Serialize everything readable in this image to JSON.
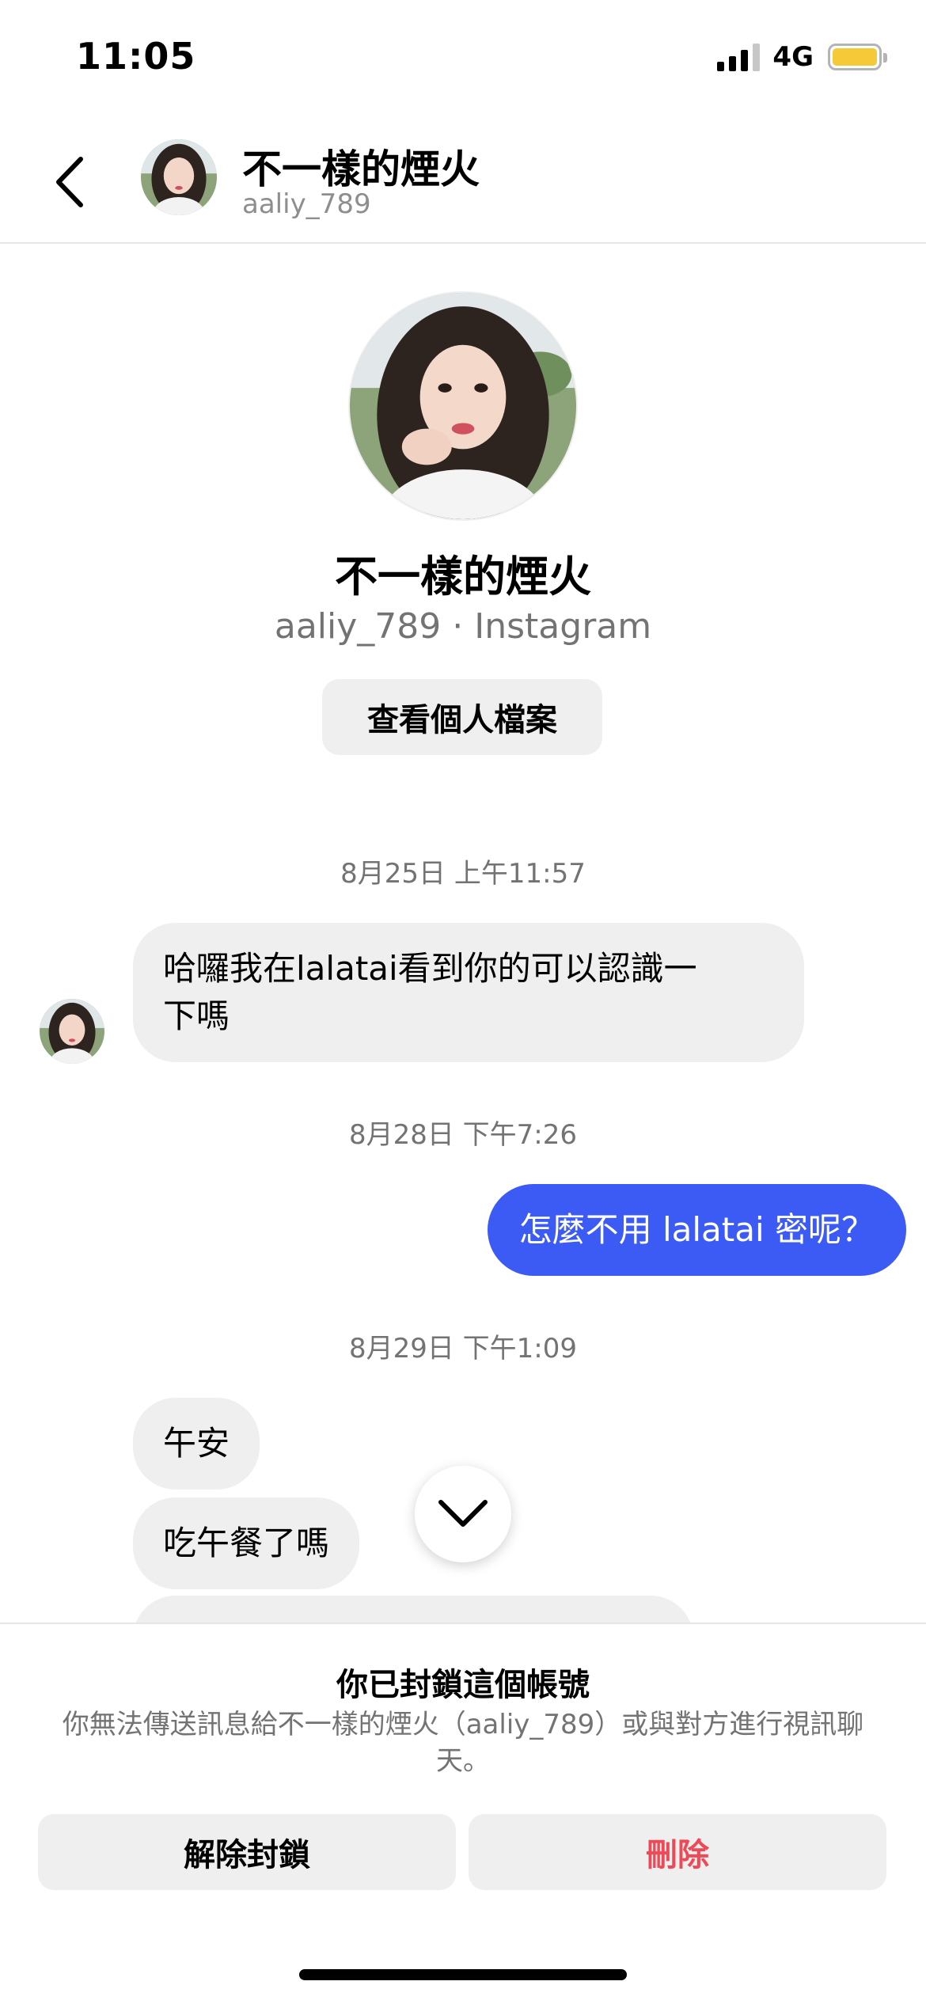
{
  "status_bar": {
    "time": "11:05",
    "network": "4G",
    "battery_color": "#f5c937",
    "icons": [
      "signal-icon",
      "battery-icon"
    ]
  },
  "header": {
    "display_name": "不一樣的煙火",
    "username": "aaliy_789",
    "back_icon": "chevron-left-icon"
  },
  "profile": {
    "display_name": "不一樣的煙火",
    "username": "aaliy_789",
    "separator": "·",
    "platform": "Instagram",
    "view_profile_label": "查看個人檔案"
  },
  "conversation": {
    "outgoing_bubble_color": "#3c5bf4",
    "incoming_bubble_color": "#efefef",
    "groups": [
      {
        "timestamp": "8月25日 上午11:57",
        "messages": [
          {
            "direction": "incoming",
            "lines": [
              "哈囉我在lalatai看到你的可以認識一",
              "下嗎"
            ]
          }
        ]
      },
      {
        "timestamp": "8月28日 下午7:26",
        "messages": [
          {
            "direction": "outgoing",
            "text": "怎麼不用 lalatai 密呢？"
          }
        ]
      },
      {
        "timestamp": "8月29日 下午1:09",
        "messages": [
          {
            "direction": "incoming",
            "text": "午安"
          },
          {
            "direction": "incoming",
            "text": "吃午餐了嗎"
          }
        ]
      }
    ],
    "scroll_icon": "chevron-down-icon"
  },
  "blocked_panel": {
    "title": "你已封鎖這個帳號",
    "description": "你無法傳送訊息給不一樣的煙火（aaliy_789）或與對方進行視訊聊天。",
    "unblock_label": "解除封鎖",
    "delete_label": "刪除",
    "delete_color": "#ed4956"
  }
}
